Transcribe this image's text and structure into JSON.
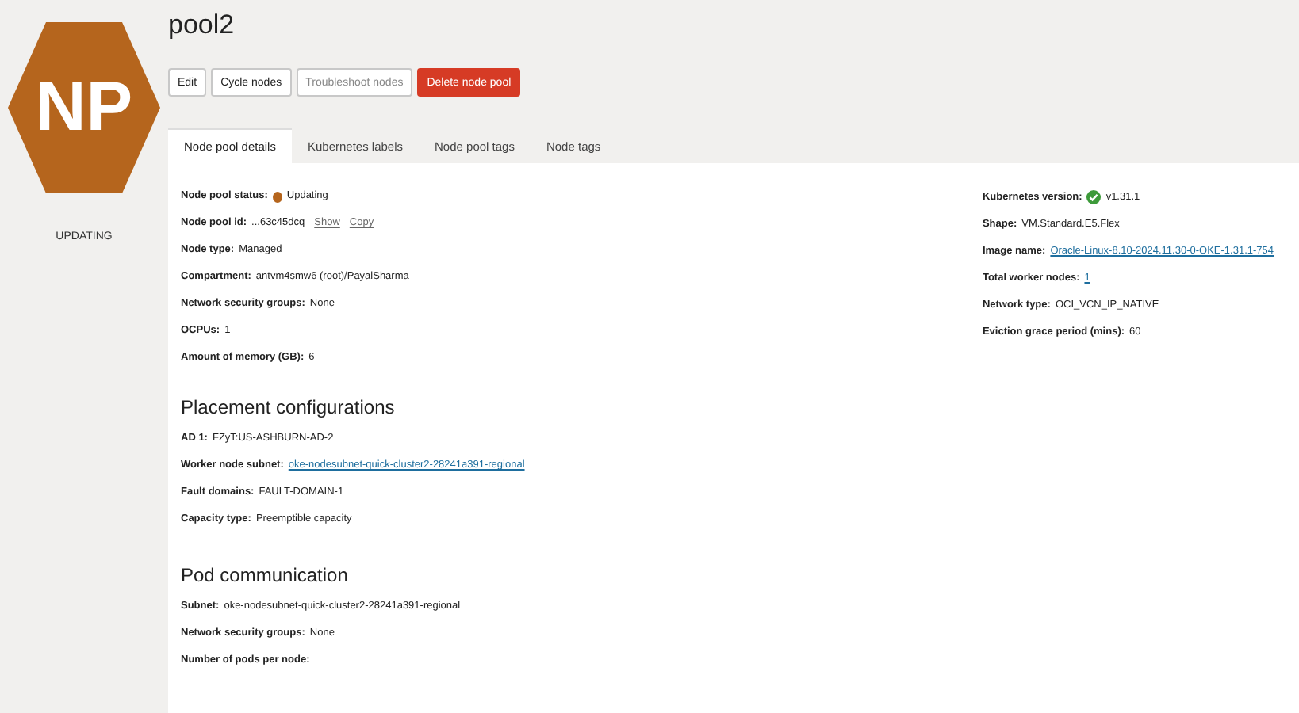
{
  "title": "pool2",
  "badge": {
    "initials": "NP",
    "status": "UPDATING",
    "color": "#b5651d"
  },
  "buttons": [
    {
      "label": "Edit",
      "kind": "default"
    },
    {
      "label": "Cycle nodes",
      "kind": "default"
    },
    {
      "label": "Troubleshoot nodes",
      "kind": "disabled"
    },
    {
      "label": "Delete node pool",
      "kind": "danger"
    }
  ],
  "tabs": [
    {
      "label": "Node pool details",
      "selected": true
    },
    {
      "label": "Kubernetes labels",
      "selected": false
    },
    {
      "label": "Node pool tags",
      "selected": false
    },
    {
      "label": "Node tags",
      "selected": false
    }
  ],
  "details_left": [
    {
      "kind": "status",
      "label": "Node pool status:",
      "value": "Updating",
      "color": "#b5651d"
    },
    {
      "kind": "id",
      "label": "Node pool id:",
      "value": "...63c45dcq",
      "links": [
        "Show",
        "Copy"
      ]
    },
    {
      "kind": "text",
      "label": "Node type:",
      "value": "Managed"
    },
    {
      "kind": "text",
      "label": "Compartment:",
      "value": "antvm4smw6 (root)/PayalSharma"
    },
    {
      "kind": "text",
      "label": "Network security groups:",
      "value": "None"
    },
    {
      "kind": "text",
      "label": "OCPUs:",
      "value": "1"
    },
    {
      "kind": "text",
      "label": "Amount of memory (GB):",
      "value": "6"
    }
  ],
  "details_right": [
    {
      "kind": "version",
      "label": "Kubernetes version:",
      "value": "v1.31.1"
    },
    {
      "kind": "text",
      "label": "Shape:",
      "value": "VM.Standard.E5.Flex"
    },
    {
      "kind": "link",
      "label": "Image name:",
      "value": "Oracle-Linux-8.10-2024.11.30-0-OKE-1.31.1-754"
    },
    {
      "kind": "link",
      "label": "Total worker nodes:",
      "value": "1"
    },
    {
      "kind": "text",
      "label": "Network type:",
      "value": "OCI_VCN_IP_NATIVE"
    },
    {
      "kind": "text",
      "label": "Eviction grace period (mins):",
      "value": "60"
    }
  ],
  "sections": [
    {
      "title": "Placement configurations",
      "fields": [
        {
          "kind": "text",
          "label": "AD 1:",
          "value": "FZyT:US-ASHBURN-AD-2"
        },
        {
          "kind": "link",
          "label": "Worker node subnet:",
          "value": "oke-nodesubnet-quick-cluster2-28241a391-regional"
        },
        {
          "kind": "text",
          "label": "Fault domains:",
          "value": "FAULT-DOMAIN-1"
        },
        {
          "kind": "text",
          "label": "Capacity type:",
          "value": "Preemptible capacity"
        }
      ]
    },
    {
      "title": "Pod communication",
      "fields": [
        {
          "kind": "text",
          "label": "Subnet:",
          "value": "oke-nodesubnet-quick-cluster2-28241a391-regional"
        },
        {
          "kind": "text",
          "label": "Network security groups:",
          "value": "None"
        },
        {
          "kind": "text",
          "label": "Number of pods per node:"
        }
      ]
    }
  ]
}
